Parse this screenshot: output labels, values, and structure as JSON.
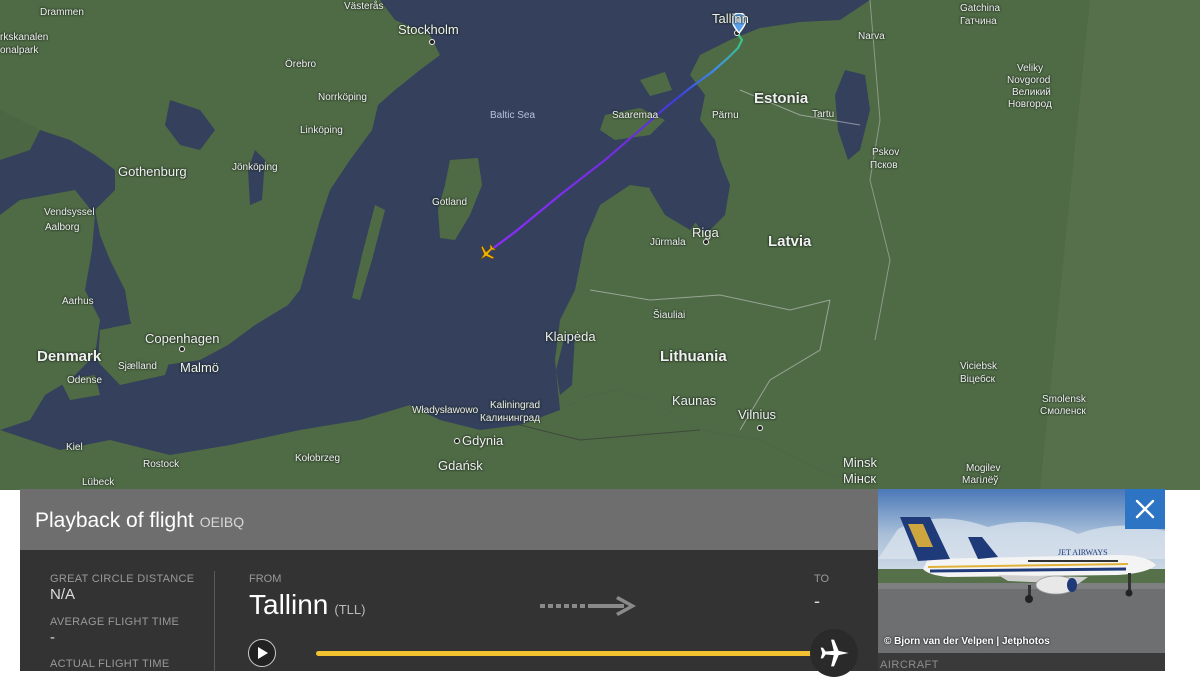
{
  "map": {
    "sea_label": "Baltic Sea",
    "cities": {
      "drammen": "Drammen",
      "vasteras": "Västerås",
      "stockholm": "Stockholm",
      "orebro": "Örebro",
      "norrkoping": "Norrköping",
      "linkoping": "Linköping",
      "gothenburg": "Gothenburg",
      "jonkoping": "Jönköping",
      "vendsyssel": "Vendsyssel",
      "aalborg": "Aalborg",
      "aarhus": "Aarhus",
      "copenhagen": "Copenhagen",
      "sjaelland": "Sjælland",
      "malmo": "Malmö",
      "odense": "Odense",
      "kiel": "Kiel",
      "lubeck": "Lübeck",
      "rostock": "Rostock",
      "kolobrzeg": "Kołobrzeg",
      "wladyslawowo": "Władysławowo",
      "gdynia": "Gdynia",
      "gdansk": "Gdańsk",
      "kaliningrad": "Kaliningrad",
      "kaliningrad_ru": "Калининград",
      "gotland": "Gotland",
      "saaremaa": "Saaremaa",
      "tallinn": "Tallinn",
      "parnu": "Pärnu",
      "tartu": "Tartu",
      "narva": "Narva",
      "gatchina": "Gatchina",
      "gatchina_ru": "Гатчина",
      "veliky": "Veliky",
      "novgorod": "Novgorod",
      "veliky_ru": "Великий",
      "novgorod_ru": "Новгород",
      "pskov": "Pskov",
      "pskov_ru": "Псков",
      "riga": "Riga",
      "jurmala": "Jūrmala",
      "siauliai": "Šiauliai",
      "klaipeda": "Klaipėda",
      "kaunas": "Kaunas",
      "vilnius": "Vilnius",
      "minsk": "Minsk",
      "minsk_ru": "Мінск",
      "viciebsk": "Viciebsk",
      "viciebsk_ru": "Віцебск",
      "smolensk": "Smolensk",
      "smolensk_ru": "Смоленск",
      "mogilev": "Mogilev",
      "mogilev_ru": "Магілёў",
      "skanalen": "rkskanalen",
      "nalpark": "onalpark"
    },
    "countries": {
      "estonia": "Estonia",
      "latvia": "Latvia",
      "lithuania": "Lithuania",
      "denmark": "Denmark"
    },
    "colors": {
      "sea": "#34405c",
      "land": "#4f6b45",
      "track_start": "#2ecc71",
      "track_mid": "#3b6be0",
      "track_end": "#9b30ff",
      "plane": "#f4b400"
    }
  },
  "panel": {
    "title": "Playback of flight",
    "registration": "OEIBQ",
    "great_circle_label": "GREAT CIRCLE DISTANCE",
    "great_circle_value": "N/A",
    "avg_time_label": "AVERAGE FLIGHT TIME",
    "avg_time_value": "-",
    "actual_time_label": "ACTUAL FLIGHT TIME",
    "from_label": "FROM",
    "from_city": "Tallinn",
    "from_code": "(TLL)",
    "to_label": "TO",
    "to_value": "-",
    "progress": 1.0
  },
  "photo": {
    "credit": "© Bjorn van der Velpen | Jetphotos",
    "airline_text": "JET AIRWAYS",
    "aircraft_label": "AIRCRAFT"
  },
  "icons": {
    "play": "play-icon",
    "close": "close-icon",
    "plane": "airplane-icon",
    "arrow": "route-arrow-icon",
    "pin": "location-pin-icon"
  }
}
